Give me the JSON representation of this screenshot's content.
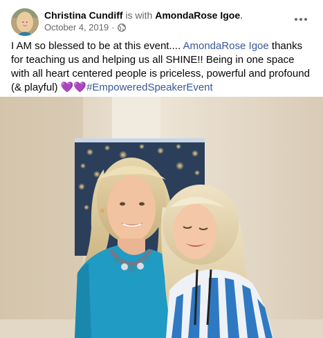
{
  "post": {
    "author": "Christina Cundiff",
    "with_text": " is with ",
    "tagged_person": "AmondaRose Igoe",
    "tagged_suffix": ".",
    "date": "October 4, 2019",
    "date_separator": " · ",
    "audience_icon": "globe-icon",
    "more_icon": "more-horizontal-icon",
    "text": {
      "part1": "I AM so blessed to be at this event....  ",
      "mention": "AmondaRose Igoe",
      "part2": " thanks for teaching us and helping us all SHINE!! Being in one space with all heart centered people is priceless, powerful and profound (& playful) ",
      "emoji": "💜💜",
      "hashtag": "#EmpoweredSpeakerEvent"
    }
  },
  "colors": {
    "link": "#385898",
    "secondary_text": "#65676b",
    "primary_text": "#050505"
  }
}
